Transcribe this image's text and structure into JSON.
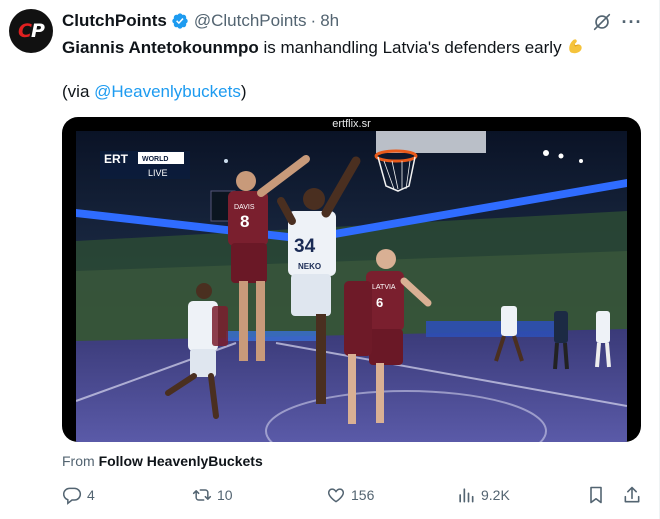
{
  "author": {
    "name": "ClutchPoints",
    "handle": "@ClutchPoints",
    "separator": "·",
    "time": "8h",
    "avatar_text_red": "C",
    "avatar_text_white": "P"
  },
  "tweet": {
    "bold_name": "Giannis Antetokounmpo",
    "text_rest": " is manhandling Latvia's defenders early",
    "via_prefix": "(via ",
    "via_mention": "@Heavenlybuckets",
    "via_suffix": ")"
  },
  "media": {
    "source_label": "ertflix.sr",
    "broadcaster": "ERT",
    "channel_tag": "WORLD",
    "live_tag": "LIVE",
    "jersey_left": "8",
    "jersey_center": "34",
    "jersey_right": "6",
    "jersey_name_left": "DAVIS",
    "jersey_name_center": "NEKO",
    "jersey_name_right": "LATVIA"
  },
  "attribution": {
    "prefix": "From ",
    "account": "Follow HeavenlyBuckets"
  },
  "actions": {
    "replies": "4",
    "reposts": "10",
    "likes": "156",
    "views": "9.2K"
  },
  "colors": {
    "accent": "#1d9bf0",
    "secondary_text": "#536471",
    "primary_text": "#0f1419",
    "verified_badge": "#1d9bf0",
    "brand_red": "#e02020"
  },
  "icons": {
    "verified": "verified-badge-icon",
    "grok": "grok-icon",
    "more": "more-icon",
    "reply": "reply-icon",
    "repost": "repost-icon",
    "like": "like-icon",
    "views": "views-icon",
    "bookmark": "bookmark-icon",
    "share": "share-icon",
    "emoji": "flexed-biceps-emoji"
  }
}
